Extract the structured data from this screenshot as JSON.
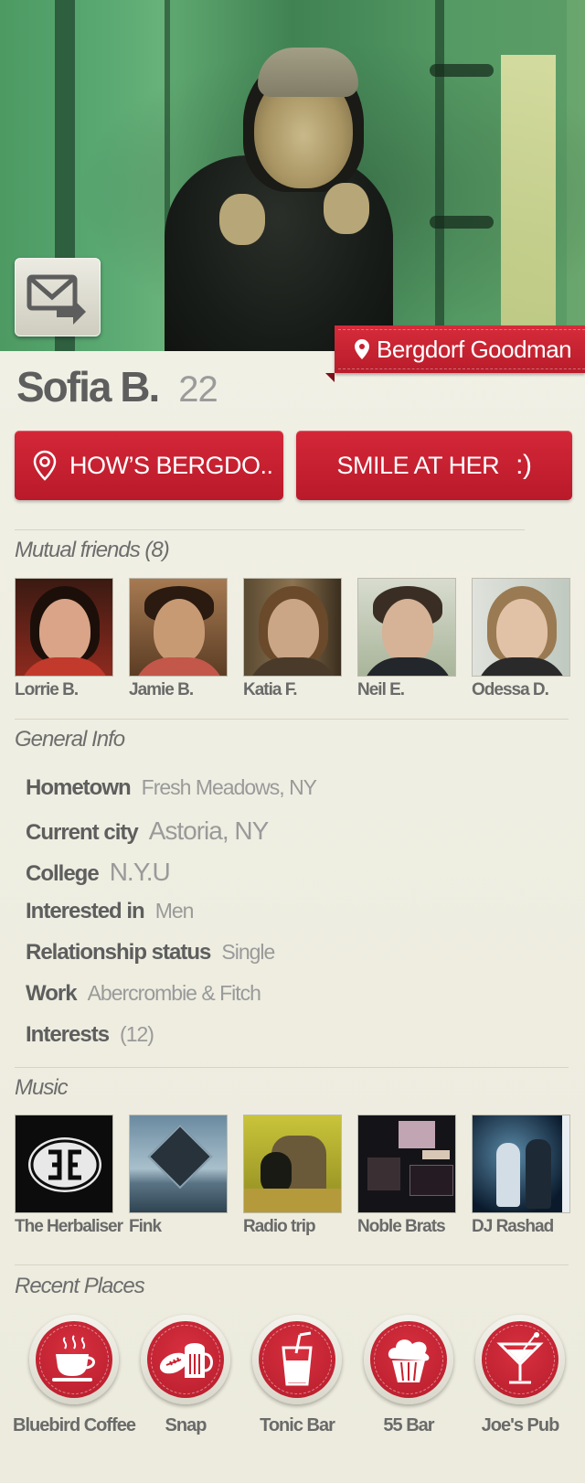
{
  "profile": {
    "name": "Sofia B.",
    "age": "22",
    "location": "Bergdorf Goodman"
  },
  "actions": {
    "how_label": "HOW’S BERGDO..",
    "smile_label": "SMILE AT HER",
    "smile_emoticon": ":)"
  },
  "mutual_friends": {
    "title": "Mutual friends (8)",
    "items": [
      {
        "name": "Lorrie B."
      },
      {
        "name": "Jamie B."
      },
      {
        "name": "Katia F."
      },
      {
        "name": "Neil E."
      },
      {
        "name": "Odessa D."
      }
    ]
  },
  "general_info": {
    "title": "General Info",
    "rows": [
      {
        "key": "Hometown",
        "value": "Fresh Meadows, NY"
      },
      {
        "key": "Current city",
        "value": "Astoria, NY"
      },
      {
        "key": "College",
        "value": "N.Y.U"
      },
      {
        "key": "Interested in",
        "value": "Men"
      },
      {
        "key": "Relationship status",
        "value": "Single"
      },
      {
        "key": "Work",
        "value": "Abercrombie & Fitch"
      },
      {
        "key": "Interests",
        "value": "(12)"
      }
    ]
  },
  "music": {
    "title": "Music",
    "items": [
      {
        "name": "The Herbaliser"
      },
      {
        "name": "Fink"
      },
      {
        "name": "Radio trip"
      },
      {
        "name": "Noble Brats"
      },
      {
        "name": "DJ Rashad"
      }
    ]
  },
  "recent_places": {
    "title": "Recent Places",
    "items": [
      {
        "name": "Bluebird Coffee",
        "icon": "coffee-cup-icon"
      },
      {
        "name": "Snap",
        "icon": "football-beer-icon"
      },
      {
        "name": "Tonic Bar",
        "icon": "soda-glass-icon"
      },
      {
        "name": "55 Bar",
        "icon": "cupcake-icon"
      },
      {
        "name": "Joe's Pub",
        "icon": "martini-glass-icon"
      }
    ]
  },
  "colors": {
    "accent_red": "#c8202f",
    "background": "#f0efe5"
  }
}
